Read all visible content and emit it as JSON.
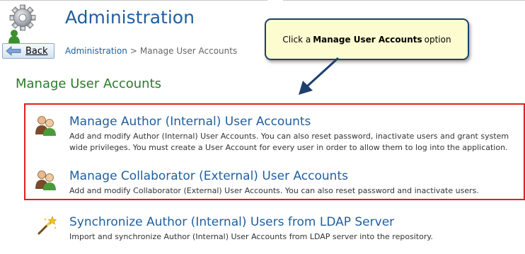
{
  "header": {
    "title": "Administration",
    "back_label": "Back"
  },
  "breadcrumb": {
    "root": "Administration",
    "separator": ">",
    "current": "Manage User Accounts"
  },
  "section": {
    "title": "Manage User Accounts"
  },
  "callout": {
    "prefix": "Click a",
    "emphasis": "Manage User Accounts",
    "suffix": "option"
  },
  "options": [
    {
      "title": "Manage Author (Internal) User Accounts",
      "description": "Add and modify Author (Internal) User Accounts. You can also reset password, inactivate users and grant system wide privileges. You must create a User Account for every user in order to allow them to log into the application.",
      "icon": "users-icon"
    },
    {
      "title": "Manage Collaborator (External) User Accounts",
      "description": "Add and modify Collaborator (External) User Accounts. You can also reset password and inactivate users.",
      "icon": "users-icon"
    },
    {
      "title": "Synchronize Author (Internal) Users from LDAP Server",
      "description": "Import and synchronize Author (Internal) User Accounts from LDAP server into the repository.",
      "icon": "magic-wand-icon"
    }
  ],
  "colors": {
    "title_blue": "#1f5fa0",
    "section_green": "#2a7a2a",
    "highlight_red": "#e02020",
    "callout_fill": "#fdfbd0",
    "callout_border": "#1d3f6e"
  }
}
